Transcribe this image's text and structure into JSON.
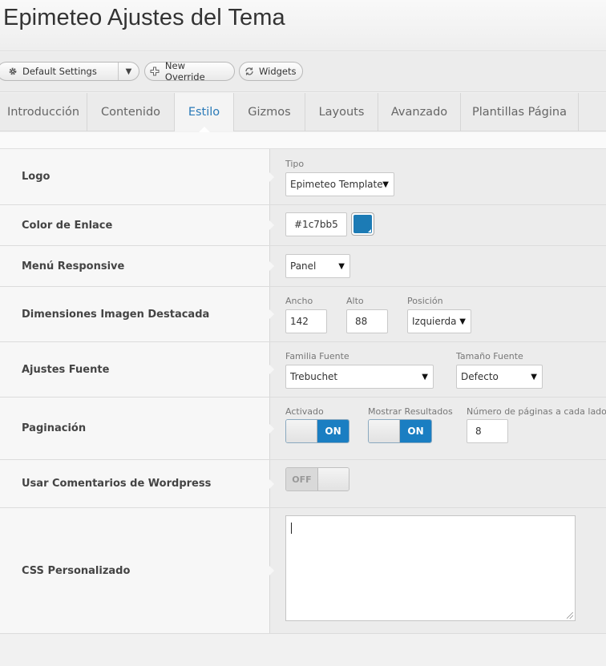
{
  "page": {
    "title": "Epimeteo Ajustes del Tema"
  },
  "toolbar": {
    "settings_select": "Default Settings",
    "new_override": "New Override",
    "widgets": "Widgets"
  },
  "tabs": [
    {
      "label": "Introducción",
      "active": false
    },
    {
      "label": "Contenido",
      "active": false
    },
    {
      "label": "Estilo",
      "active": true
    },
    {
      "label": "Gizmos",
      "active": false
    },
    {
      "label": "Layouts",
      "active": false
    },
    {
      "label": "Avanzado",
      "active": false
    },
    {
      "label": "Plantillas Página",
      "active": false
    }
  ],
  "colors": {
    "accent": "#1c7bb5",
    "toggle_on": "#1a7ec2",
    "active_tab": "#2a7ab8"
  },
  "settings": {
    "logo": {
      "label": "Logo",
      "tipo_caption": "Tipo",
      "tipo_value": "Epimeteo Template"
    },
    "link_color": {
      "label": "Color de Enlace",
      "value": "#1c7bb5"
    },
    "responsive_menu": {
      "label": "Menú Responsive",
      "value": "Panel"
    },
    "featured_image": {
      "label": "Dimensiones Imagen Destacada",
      "width_caption": "Ancho",
      "width_value": "142",
      "height_caption": "Alto",
      "height_value": "88",
      "position_caption": "Posición",
      "position_value": "Izquierda"
    },
    "font": {
      "label": "Ajustes Fuente",
      "family_caption": "Familia Fuente",
      "family_value": "Trebuchet",
      "size_caption": "Tamaño Fuente",
      "size_value": "Defecto"
    },
    "pagination": {
      "label": "Paginación",
      "enabled_caption": "Activado",
      "enabled_state": "ON",
      "results_caption": "Mostrar Resultados",
      "results_state": "ON",
      "pages_caption": "Número de páginas a cada lado",
      "pages_value": "8"
    },
    "wp_comments": {
      "label": "Usar Comentarios de Wordpress",
      "state": "OFF"
    },
    "custom_css": {
      "label": "CSS Personalizado",
      "value": ""
    }
  }
}
